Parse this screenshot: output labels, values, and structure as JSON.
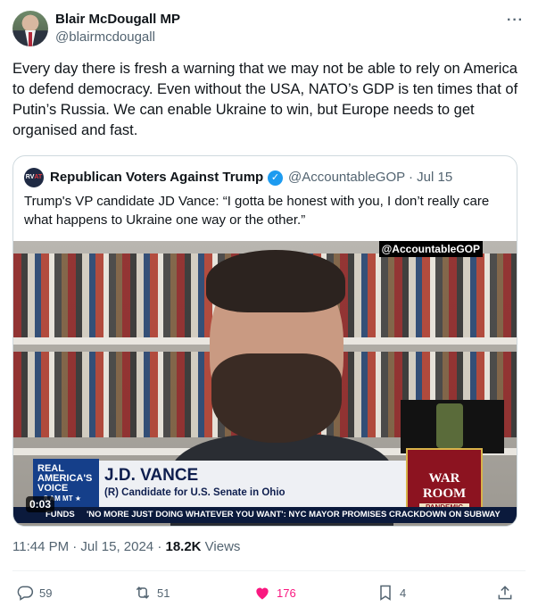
{
  "author": {
    "name": "Blair McDougall MP",
    "handle": "@blairmcdougall"
  },
  "more_icon": "ellipsis-icon",
  "tweet_text": "Every day there is fresh a warning that we may not be able to rely on America to defend democracy. Even without the USA, NATO’s GDP is ten times that of Putin’s Russia. We can enable Ukraine to win, but Europe needs to get organised and fast.",
  "quoted": {
    "avatar_text": "RV",
    "avatar_text_accent": "AT",
    "name": "Republican Voters Against Trump",
    "handle_date": "@AccountableGOP · Jul 15",
    "text": "Trump's VP candidate JD Vance: “I gotta be honest with you, I don’t really care what happens to Ukraine one way or the other.”",
    "video": {
      "watermark": "@AccountableGOP",
      "logo_line1": "REAL",
      "logo_line2": "AMERICA'S",
      "logo_line3": "VOICE",
      "logo_time": "8 AM MT ★",
      "lower_third_name": "J.D. VANCE",
      "lower_third_sub": "(R) Candidate for U.S. Senate in Ohio",
      "warroom_title": "WAR ROOM",
      "warroom_sub": "PANDEMIC",
      "ticker_left": "FUNDS",
      "ticker_text": "'NO MORE JUST DOING WHATEVER YOU WANT': NYC MAYOR PROMISES CRACKDOWN ON SUBWAY",
      "timestamp": "0:03"
    }
  },
  "meta": {
    "time_date": "11:44 PM · Jul 15, 2024 · ",
    "views_count": "18.2K",
    "views_label": " Views"
  },
  "actions": {
    "replies": "59",
    "reposts": "51",
    "likes": "176",
    "bookmarks": "4"
  },
  "colors": {
    "like_active": "#f91880",
    "verified": "#1d9bf0",
    "secondary_text": "#536471"
  }
}
